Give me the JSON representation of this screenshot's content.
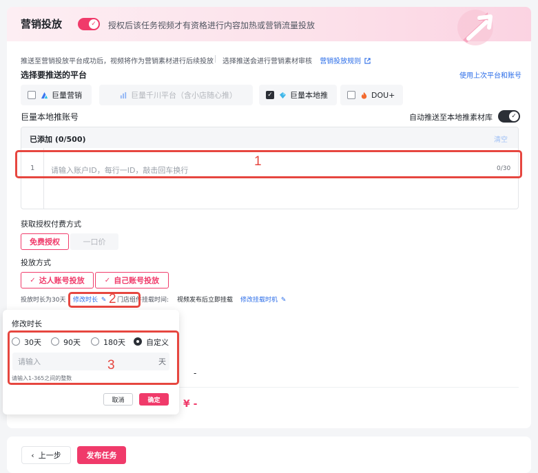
{
  "header": {
    "title": "营销投放",
    "description": "授权后该任务视频才有资格进行内容加热或营销流量投放"
  },
  "info": {
    "line1": "推送至营销投放平台成功后，视频将作为营销素材进行后续投放",
    "line2": "选择推送会进行营销素材审核",
    "rules_link": "营销投放规则"
  },
  "platform_section": {
    "label": "选择要推送的平台",
    "reuse_link": "使用上次平台和账号",
    "options": [
      {
        "label": "巨量营销",
        "checked": false
      },
      {
        "label": "巨量千川平台（含小店随心推）",
        "checked": false,
        "disabled": true
      },
      {
        "label": "巨量本地推",
        "checked": true
      },
      {
        "label": "DOU+",
        "checked": false
      }
    ]
  },
  "account_section": {
    "label": "巨量本地推账号",
    "auto_push_label": "自动推送至本地推素材库",
    "added_title": "已添加 (0/500)",
    "clear_label": "清空",
    "line_number": "1",
    "placeholder": "请输入账户ID，每行一ID，敲击回车换行",
    "counter": "0/30"
  },
  "auth_section": {
    "label": "获取授权付费方式",
    "options": [
      "免费授权",
      "一口价"
    ]
  },
  "delivery_section": {
    "label": "投放方式",
    "options": [
      "达人账号投放",
      "自己账号投放"
    ],
    "duration_prefix": "投放时长为30天",
    "modify_duration": "修改时长",
    "store_text": "门店组件挂载时间:",
    "mount_value": "视频发布后立即挂载",
    "modify_mount": "修改挂载时机"
  },
  "popover": {
    "title": "修改时长",
    "options": [
      "30天",
      "90天",
      "180天",
      "自定义"
    ],
    "selected": "自定义",
    "placeholder": "请输入",
    "unit": "天",
    "hint": "请输入1-365之间的整数",
    "cancel": "取消",
    "confirm": "确定"
  },
  "summary": {
    "dash": "-",
    "price": "¥ -"
  },
  "annotations": [
    "1",
    "2",
    "3"
  ],
  "footer": {
    "back": "上一步",
    "publish": "发布任务"
  },
  "colors": {
    "brand_pink": "#f03a6a",
    "link_blue": "#2a6ce8",
    "annotation_red": "#e6463f",
    "dark_toggle": "#2b2f36"
  }
}
